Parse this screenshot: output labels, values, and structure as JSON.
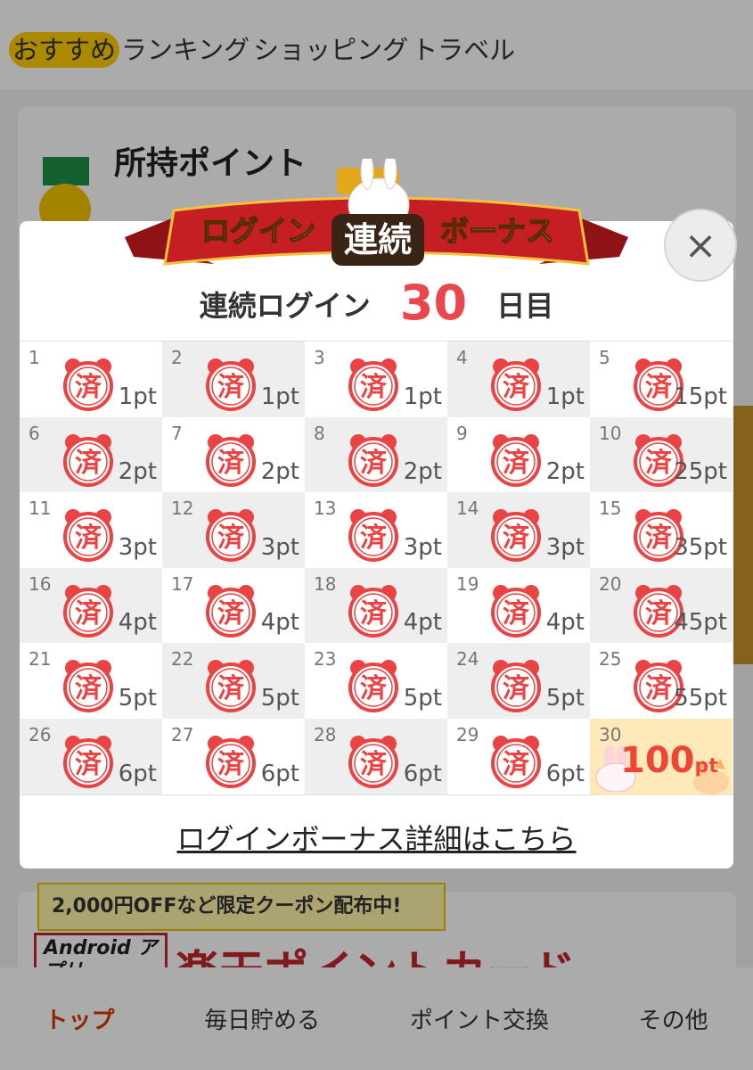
{
  "top_tabs": [
    "おすすめ",
    "ランキング",
    "ショッピング",
    "トラベル"
  ],
  "points_card": {
    "title": "所持ポイント"
  },
  "coupon_strip": "2,000円OFFなど限定クーポン配布中!",
  "banner": {
    "android_label": "Android アプリ",
    "title": "楽天ポイントカード"
  },
  "bottom_nav": [
    "トップ",
    "毎日貯める",
    "ポイント交換",
    "その他"
  ],
  "modal": {
    "ribbon": {
      "left": "ログイン",
      "center": "連続",
      "right": "ボーナス"
    },
    "streak_prefix": "連続ログイン",
    "streak_days": "30",
    "streak_suffix": "日目",
    "stamp_text": "済",
    "days": [
      {
        "day": "1",
        "pts": "1pt"
      },
      {
        "day": "2",
        "pts": "1pt"
      },
      {
        "day": "3",
        "pts": "1pt"
      },
      {
        "day": "4",
        "pts": "1pt"
      },
      {
        "day": "5",
        "pts": "15pt"
      },
      {
        "day": "6",
        "pts": "2pt"
      },
      {
        "day": "7",
        "pts": "2pt"
      },
      {
        "day": "8",
        "pts": "2pt"
      },
      {
        "day": "9",
        "pts": "2pt"
      },
      {
        "day": "10",
        "pts": "25pt"
      },
      {
        "day": "11",
        "pts": "3pt"
      },
      {
        "day": "12",
        "pts": "3pt"
      },
      {
        "day": "13",
        "pts": "3pt"
      },
      {
        "day": "14",
        "pts": "3pt"
      },
      {
        "day": "15",
        "pts": "35pt"
      },
      {
        "day": "16",
        "pts": "4pt"
      },
      {
        "day": "17",
        "pts": "4pt"
      },
      {
        "day": "18",
        "pts": "4pt"
      },
      {
        "day": "19",
        "pts": "4pt"
      },
      {
        "day": "20",
        "pts": "45pt"
      },
      {
        "day": "21",
        "pts": "5pt"
      },
      {
        "day": "22",
        "pts": "5pt"
      },
      {
        "day": "23",
        "pts": "5pt"
      },
      {
        "day": "24",
        "pts": "5pt"
      },
      {
        "day": "25",
        "pts": "55pt"
      },
      {
        "day": "26",
        "pts": "6pt"
      },
      {
        "day": "27",
        "pts": "6pt"
      },
      {
        "day": "28",
        "pts": "6pt"
      },
      {
        "day": "29",
        "pts": "6pt"
      }
    ],
    "final_day": {
      "day": "30",
      "pts_num": "100",
      "pts_unit": "pt"
    },
    "details_link": "ログインボーナス詳細はこちら",
    "close_symbol": "×"
  },
  "colors": {
    "stamp_red": "#ea4343",
    "ribbon_red": "#c51f25",
    "accent_yellow": "#ffcc00"
  }
}
